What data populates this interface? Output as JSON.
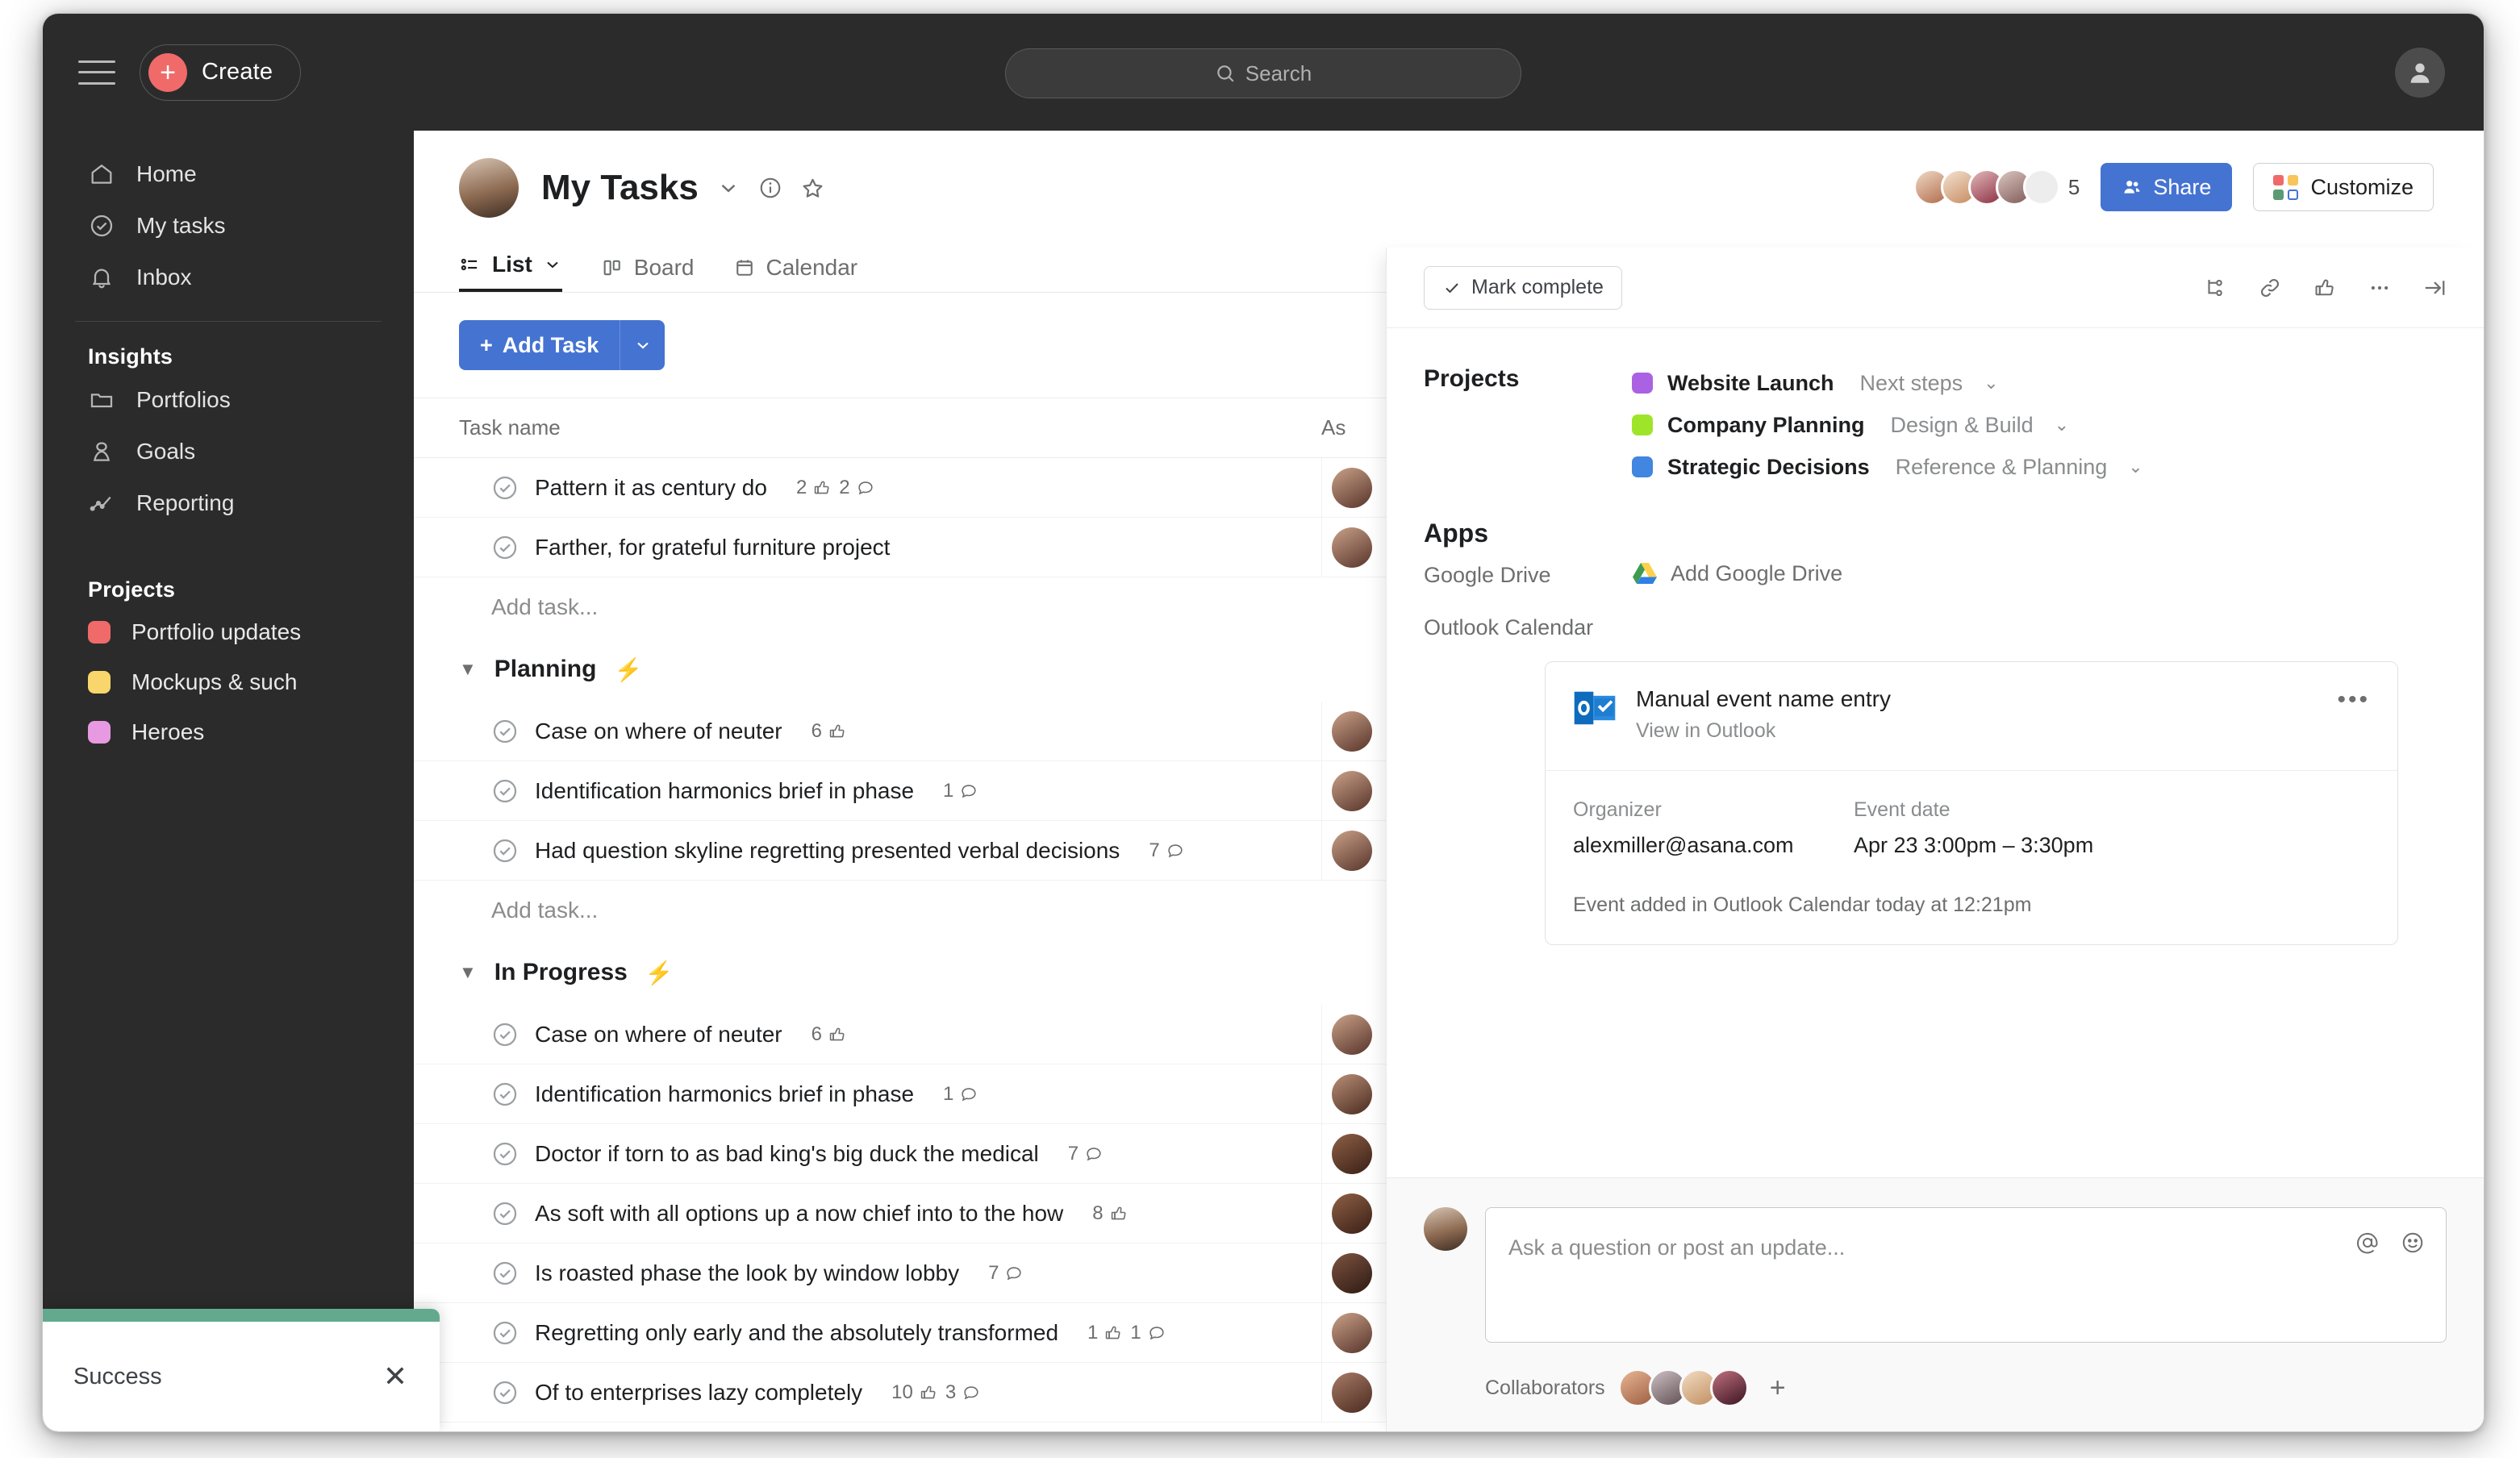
{
  "topbar": {
    "menu_icon": "hamburger-icon",
    "create_label": "Create",
    "search_placeholder": "Search",
    "search_icon": "search-icon",
    "profile_icon": "person-icon"
  },
  "sidebar": {
    "nav": [
      {
        "label": "Home",
        "icon": "home-icon"
      },
      {
        "label": "My tasks",
        "icon": "check-circle-icon"
      },
      {
        "label": "Inbox",
        "icon": "bell-icon"
      }
    ],
    "insights_heading": "Insights",
    "insights": [
      {
        "label": "Portfolios",
        "icon": "folder-icon"
      },
      {
        "label": "Goals",
        "icon": "goal-person-icon"
      },
      {
        "label": "Reporting",
        "icon": "line-chart-icon"
      }
    ],
    "projects_heading": "Projects",
    "projects": [
      {
        "label": "Portfolio updates",
        "color": "#f06a6a"
      },
      {
        "label": "Mockups & such",
        "color": "#f8d66b"
      },
      {
        "label": "Heroes",
        "color": "#e79ae2"
      }
    ]
  },
  "header": {
    "title": "My Tasks",
    "caret_icon": "chevron-down-icon",
    "info_icon": "info-circle-icon",
    "star_icon": "star-icon",
    "overflow_count": "5",
    "share_label": "Share",
    "share_icon": "people-icon",
    "customize_label": "Customize",
    "customize_icon": "grid-icon",
    "share_color": "#4573d2",
    "avatars": [
      "#d9a583",
      "#e3c3a5",
      "#8b4a56",
      "#c0a0a8",
      "#e8e8e8"
    ]
  },
  "tabs": [
    {
      "label": "List",
      "icon": "list-icon",
      "active": true,
      "caret": true
    },
    {
      "label": "Board",
      "icon": "board-icon",
      "active": false,
      "caret": false
    },
    {
      "label": "Calendar",
      "icon": "calendar-icon",
      "active": false,
      "caret": false
    }
  ],
  "toolbar": {
    "add_task_label": "Add Task",
    "add_task_plus": "plus-icon",
    "add_task_caret": "chevron-down-icon"
  },
  "table": {
    "columns": [
      "Task name",
      "As"
    ],
    "add_task_placeholder": "Add task...",
    "sections": [
      {
        "title": "",
        "bolt": false,
        "rows": [
          {
            "title": "Pattern it as century do",
            "likes": "2",
            "comments": "2",
            "avatar": "#8a5a42"
          },
          {
            "title": "Farther, for grateful furniture project",
            "likes": "",
            "comments": "",
            "avatar": "#8a5a42"
          }
        ]
      },
      {
        "title": "Planning",
        "bolt": true,
        "rows": [
          {
            "title": "Case on where of neuter",
            "likes": "6",
            "comments": "",
            "avatar": "#8a5a42"
          },
          {
            "title": "Identification harmonics brief in phase",
            "likes": "",
            "comments": "1",
            "avatar": "#8a5a42"
          },
          {
            "title": "Had question skyline regretting presented verbal decisions",
            "likes": "",
            "comments": "7",
            "avatar": "#8a5a42"
          }
        ]
      },
      {
        "title": "In Progress",
        "bolt": true,
        "rows": [
          {
            "title": "Case on where of neuter",
            "likes": "6",
            "comments": "",
            "avatar": "#8a5a42"
          },
          {
            "title": "Identification harmonics brief in phase",
            "likes": "",
            "comments": "1",
            "avatar": "#7b4a3a"
          },
          {
            "title": "Doctor if torn to as bad king's big duck the medical",
            "likes": "",
            "comments": "7",
            "avatar": "#5c3326"
          },
          {
            "title": "As soft with all options up a now chief into to the how",
            "likes": "8",
            "comments": "",
            "avatar": "#5c3326"
          },
          {
            "title": "Is roasted phase the look by window lobby",
            "likes": "",
            "comments": "7",
            "avatar": "#4a2b20"
          },
          {
            "title": "Regretting only early and the absolutely transformed",
            "likes": "1",
            "comments": "1",
            "avatar": "#8a5a42"
          },
          {
            "title": "Of to enterprises lazy completely",
            "likes": "10",
            "comments": "3",
            "avatar": "#6b3b2e"
          }
        ]
      }
    ]
  },
  "panel": {
    "mark_complete_label": "Mark complete",
    "mark_complete_icon": "check-icon",
    "icons": [
      "subtask-icon",
      "link-icon",
      "thumbs-up-icon",
      "ellipsis-icon",
      "collapse-right-icon"
    ],
    "projects_label": "Projects",
    "projects": [
      {
        "name": "Website Launch",
        "stage": "Next steps",
        "color": "#aa62e3",
        "caret": "chevron-down-icon"
      },
      {
        "name": "Company Planning",
        "stage": "Design & Build",
        "color": "#9ee52a",
        "caret": "chevron-down-icon"
      },
      {
        "name": "Strategic Decisions",
        "stage": "Reference & Planning",
        "color": "#4186e0",
        "caret": "chevron-down-icon"
      }
    ],
    "apps_heading": "Apps",
    "gdrive_label": "Google Drive",
    "gdrive_add_label": "Add Google Drive",
    "gdrive_icon": "google-drive-icon",
    "outlook_label": "Outlook Calendar",
    "event": {
      "icon": "outlook-icon",
      "name": "Manual event name entry",
      "view_link": "View in Outlook",
      "more_icon": "ellipsis-icon",
      "organizer_key": "Organizer",
      "organizer_value": "alexmiller@asana.com",
      "date_key": "Event date",
      "date_value": "Apr 23 3:00pm –  3:30pm",
      "footnote": "Event added in Outlook Calendar today at 12:21pm"
    }
  },
  "composer": {
    "placeholder": "Ask a question or post an update...",
    "mention_icon": "at-icon",
    "emoji_icon": "smiley-icon",
    "collaborators_label": "Collaborators",
    "collaborator_avatars": [
      "#c98a6a",
      "#9b8e96",
      "#d9b48f",
      "#5b2f3a"
    ],
    "add_collaborator_icon": "plus-icon"
  },
  "toast": {
    "text": "Success",
    "close_icon": "close-icon",
    "accent_color": "#62a98e"
  }
}
